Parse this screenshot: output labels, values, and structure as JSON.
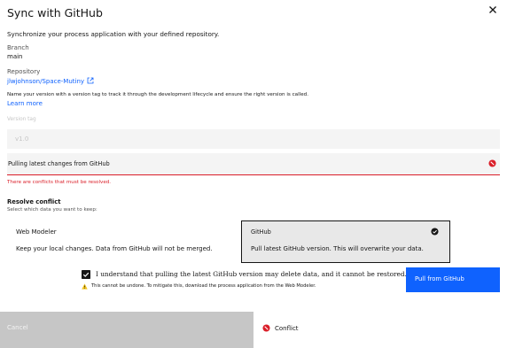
{
  "dialog": {
    "title": "Sync with GitHub",
    "subtitle": "Synchronize your process application with your defined repository."
  },
  "branch": {
    "label": "Branch",
    "value": "main"
  },
  "repository": {
    "label": "Repository",
    "value": "jlwjohnson/Space-Mutiny"
  },
  "version": {
    "description": "Name your version with a version tag to track it through the development lifecycle and ensure the right version is called.",
    "learn_more": "Learn more",
    "tag_label": "Version tag",
    "tag_placeholder": "v1.0"
  },
  "pull_status": {
    "text": "Pulling latest changes from GitHub",
    "error": "There are conflicts that must be resolved."
  },
  "resolve": {
    "title": "Resolve conflict",
    "subtitle": "Select which data you want to keep:",
    "options": [
      {
        "name": "Web Modeler",
        "description": "Keep your local changes. Data from GitHub will not be merged.",
        "selected": false
      },
      {
        "name": "GitHub",
        "description": "Pull latest GitHub version. This will overwrite your data.",
        "selected": true
      }
    ]
  },
  "confirm": {
    "label": "I understand that pulling the latest GitHub version may delete data, and it cannot be restored.",
    "checked": true,
    "warning": "This cannot be undone. To mitigate this, download the process application from the Web Modeler."
  },
  "buttons": {
    "pull": "Pull from GitHub",
    "cancel": "Cancel"
  },
  "footer_status": {
    "label": "Conflict"
  },
  "icons": {
    "close": "close-icon",
    "external_link": "external-link-icon",
    "error": "error-icon",
    "checkmark": "checkmark-filled-icon",
    "checkbox": "checkbox-checked-icon",
    "warning": "warning-icon"
  },
  "colors": {
    "accent": "#0f62fe",
    "error": "#da1e28",
    "warning": "#f1c21b"
  }
}
